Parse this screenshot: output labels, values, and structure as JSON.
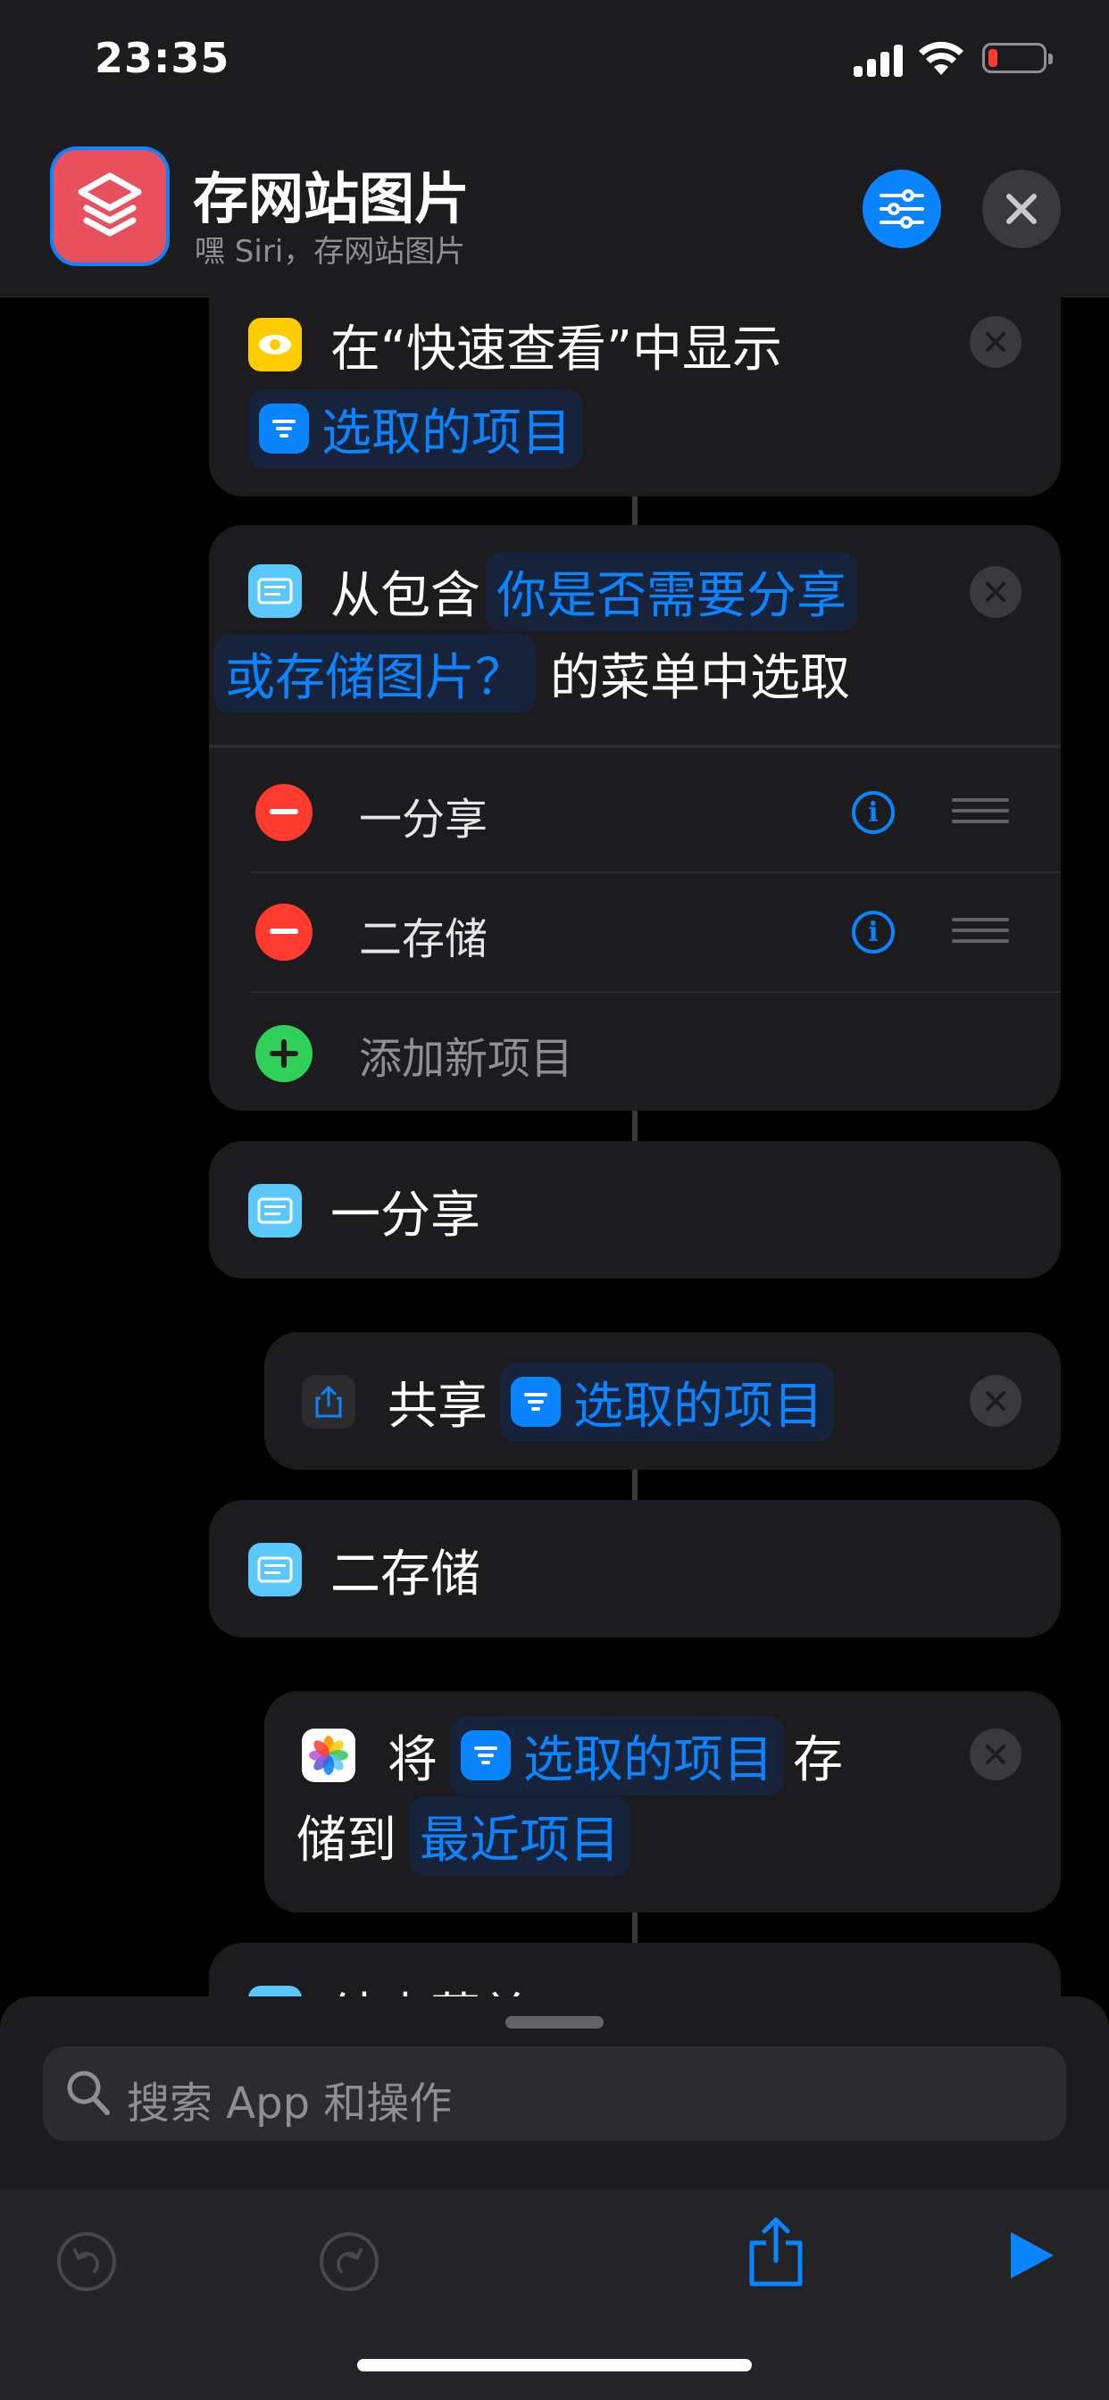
{
  "status_bar": {
    "time": "23:35"
  },
  "header": {
    "title": "存网站图片",
    "subtitle": "嘿 Siri，存网站图片"
  },
  "actions": {
    "quicklook": {
      "text": "在“快速查看”中显示",
      "token": "选取的项目"
    },
    "choose_menu": {
      "prefix": "从包含",
      "prompt_line1": "你是否需要分享",
      "prompt_line2": "或存储图片？",
      "suffix": "的菜单中选取",
      "items": [
        {
          "label": "一分享"
        },
        {
          "label": "二存储"
        }
      ],
      "add_item_label": "添加新项目"
    },
    "case_share": {
      "label": "一分享"
    },
    "share": {
      "verb": "共享",
      "token": "选取的项目"
    },
    "case_save": {
      "label": "二存储"
    },
    "save_photos": {
      "verb": "将",
      "token": "选取的项目",
      "tail": "存",
      "line2_prefix": "储到",
      "album_token": "最近项目"
    },
    "end_menu": {
      "label": "结束菜单"
    }
  },
  "search": {
    "placeholder": "搜索 App 和操作"
  },
  "colors": {
    "accent": "#0a84ff",
    "remove_red": "#ff3b30",
    "add_green": "#30d158",
    "app_icon": "#e9505d"
  }
}
